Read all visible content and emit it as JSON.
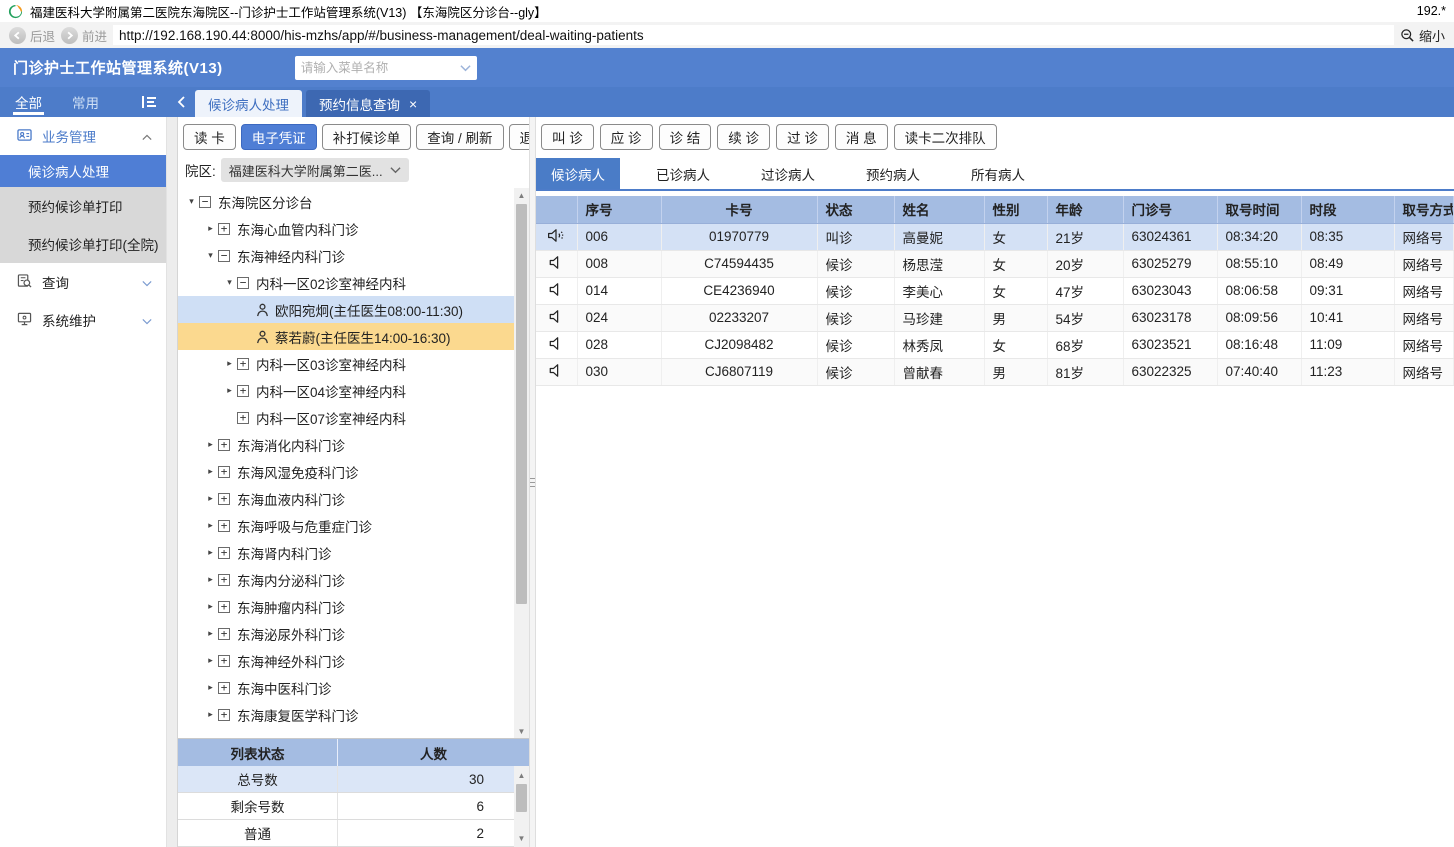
{
  "window": {
    "title": "福建医科大学附属第二医院东海院区--门诊护士工作站管理系统(V13) 【东海院区分诊台--gly】",
    "right_text": "192.*"
  },
  "navbar": {
    "back_label": "后退",
    "forward_label": "前进",
    "url": "http://192.168.190.44:8000/his-mzhs/app/#/business-management/deal-waiting-patients",
    "zoom_out_label": "缩小"
  },
  "app_header": {
    "title": "门诊护士工作站管理系统(V13)",
    "menu_search_placeholder": "请输入菜单名称"
  },
  "nav_tabs": {
    "side_tabs": [
      {
        "label": "全部",
        "active": true
      },
      {
        "label": "常用",
        "active": false
      }
    ],
    "doc_tabs": [
      {
        "label": "候诊病人处理",
        "active": true,
        "closable": false
      },
      {
        "label": "预约信息查询",
        "active": false,
        "closable": true
      }
    ],
    "close_glyph": "×"
  },
  "sidebar": {
    "items": [
      {
        "type": "group",
        "icon": "business-icon",
        "label": "业务管理",
        "expanded": true,
        "accent": true
      },
      {
        "type": "item",
        "label": "候诊病人处理",
        "active": true
      },
      {
        "type": "item",
        "label": "预约候诊单打印",
        "active": false
      },
      {
        "type": "item",
        "label": "预约候诊单打印(全院)",
        "active": false
      },
      {
        "type": "group",
        "icon": "query-icon",
        "label": "查询",
        "expanded": false,
        "accent": false
      },
      {
        "type": "group",
        "icon": "maintenance-icon",
        "label": "系统维护",
        "expanded": false,
        "accent": false
      }
    ]
  },
  "tree_panel": {
    "toolbar": [
      {
        "label": "读 卡",
        "primary": false
      },
      {
        "label": "电子凭证",
        "primary": true
      },
      {
        "label": "补打候诊单",
        "primary": false
      },
      {
        "label": "查询 / 刷新",
        "primary": false
      },
      {
        "label": "退 出",
        "primary": false
      }
    ],
    "campus_label": "院区:",
    "campus_value": "福建医科大学附属第二医...",
    "tree": [
      {
        "level": 0,
        "arrow": "down",
        "box": "minus",
        "person": false,
        "label": "东海院区分诊台",
        "highlight": ""
      },
      {
        "level": 1,
        "arrow": "right",
        "box": "plus",
        "person": false,
        "label": "东海心血管内科门诊",
        "highlight": ""
      },
      {
        "level": 1,
        "arrow": "down",
        "box": "minus",
        "person": false,
        "label": "东海神经内科门诊",
        "highlight": ""
      },
      {
        "level": 2,
        "arrow": "down",
        "box": "minus",
        "person": false,
        "label": "内科一区02诊室神经内科",
        "highlight": ""
      },
      {
        "level": 3,
        "arrow": "none",
        "box": "none",
        "person": true,
        "label": "欧阳宛炯(主任医生08:00-11:30)",
        "highlight": "blue"
      },
      {
        "level": 3,
        "arrow": "none",
        "box": "none",
        "person": true,
        "label": "蔡若蔚(主任医生14:00-16:30)",
        "highlight": "orange"
      },
      {
        "level": 2,
        "arrow": "right",
        "box": "plus",
        "person": false,
        "label": "内科一区03诊室神经内科",
        "highlight": ""
      },
      {
        "level": 2,
        "arrow": "right",
        "box": "plus",
        "person": false,
        "label": "内科一区04诊室神经内科",
        "highlight": ""
      },
      {
        "level": 2,
        "arrow": "none",
        "box": "plus",
        "person": false,
        "label": "内科一区07诊室神经内科",
        "highlight": ""
      },
      {
        "level": 1,
        "arrow": "right",
        "box": "plus",
        "person": false,
        "label": "东海消化内科门诊",
        "highlight": ""
      },
      {
        "level": 1,
        "arrow": "right",
        "box": "plus",
        "person": false,
        "label": "东海风湿免疫科门诊",
        "highlight": ""
      },
      {
        "level": 1,
        "arrow": "right",
        "box": "plus",
        "person": false,
        "label": "东海血液内科门诊",
        "highlight": ""
      },
      {
        "level": 1,
        "arrow": "right",
        "box": "plus",
        "person": false,
        "label": "东海呼吸与危重症门诊",
        "highlight": ""
      },
      {
        "level": 1,
        "arrow": "right",
        "box": "plus",
        "person": false,
        "label": "东海肾内科门诊",
        "highlight": ""
      },
      {
        "level": 1,
        "arrow": "right",
        "box": "plus",
        "person": false,
        "label": "东海内分泌科门诊",
        "highlight": ""
      },
      {
        "level": 1,
        "arrow": "right",
        "box": "plus",
        "person": false,
        "label": "东海肿瘤内科门诊",
        "highlight": ""
      },
      {
        "level": 1,
        "arrow": "right",
        "box": "plus",
        "person": false,
        "label": "东海泌尿外科门诊",
        "highlight": ""
      },
      {
        "level": 1,
        "arrow": "right",
        "box": "plus",
        "person": false,
        "label": "东海神经外科门诊",
        "highlight": ""
      },
      {
        "level": 1,
        "arrow": "right",
        "box": "plus",
        "person": false,
        "label": "东海中医科门诊",
        "highlight": ""
      },
      {
        "level": 1,
        "arrow": "right",
        "box": "plus",
        "person": false,
        "label": "东海康复医学科门诊",
        "highlight": ""
      }
    ],
    "stats": {
      "headers": [
        "列表状态",
        "人数"
      ],
      "rows": [
        {
          "label": "总号数",
          "value": "30",
          "highlight": true
        },
        {
          "label": "剩余号数",
          "value": "6",
          "highlight": false
        },
        {
          "label": "普通",
          "value": "2",
          "highlight": false
        }
      ]
    }
  },
  "patient_panel": {
    "toolbar": [
      {
        "label": "叫 诊"
      },
      {
        "label": "应 诊"
      },
      {
        "label": "诊 结"
      },
      {
        "label": "续 诊"
      },
      {
        "label": "过 诊"
      },
      {
        "label": "消 息"
      },
      {
        "label": "读卡二次排队"
      }
    ],
    "tabs": [
      {
        "label": "候诊病人",
        "active": true
      },
      {
        "label": "已诊病人",
        "active": false
      },
      {
        "label": "过诊病人",
        "active": false
      },
      {
        "label": "预约病人",
        "active": false
      },
      {
        "label": "所有病人",
        "active": false
      }
    ],
    "table": {
      "columns": [
        "",
        "序号",
        "卡号",
        "状态",
        "姓名",
        "性别",
        "年龄",
        "门诊号",
        "取号时间",
        "时段",
        "取号方式"
      ],
      "rows": [
        {
          "seq": "006",
          "card": "01970779",
          "status": "叫诊",
          "name": "高曼妮",
          "sex": "女",
          "age": "21岁",
          "clinic_no": "63024361",
          "take_time": "08:34:20",
          "slot": "08:35",
          "method": "网络号",
          "calling": true,
          "selected": true
        },
        {
          "seq": "008",
          "card": "C74594435",
          "status": "候诊",
          "name": "杨思滢",
          "sex": "女",
          "age": "20岁",
          "clinic_no": "63025279",
          "take_time": "08:55:10",
          "slot": "08:49",
          "method": "网络号",
          "calling": false,
          "selected": false
        },
        {
          "seq": "014",
          "card": "CE4236940",
          "status": "候诊",
          "name": "李美心",
          "sex": "女",
          "age": "47岁",
          "clinic_no": "63023043",
          "take_time": "08:06:58",
          "slot": "09:31",
          "method": "网络号",
          "calling": false,
          "selected": false
        },
        {
          "seq": "024",
          "card": "02233207",
          "status": "候诊",
          "name": "马珍建",
          "sex": "男",
          "age": "54岁",
          "clinic_no": "63023178",
          "take_time": "08:09:56",
          "slot": "10:41",
          "method": "网络号",
          "calling": false,
          "selected": false
        },
        {
          "seq": "028",
          "card": "CJ2098482",
          "status": "候诊",
          "name": "林秀凤",
          "sex": "女",
          "age": "68岁",
          "clinic_no": "63023521",
          "take_time": "08:16:48",
          "slot": "11:09",
          "method": "网络号",
          "calling": false,
          "selected": false
        },
        {
          "seq": "030",
          "card": "CJ6807119",
          "status": "候诊",
          "name": "曾献春",
          "sex": "男",
          "age": "81岁",
          "clinic_no": "63022325",
          "take_time": "07:40:40",
          "slot": "11:23",
          "method": "网络号",
          "calling": false,
          "selected": false
        }
      ]
    }
  },
  "icons": {
    "logo": "hospital-logo-swirl",
    "speaker_calling": "speaker-active-icon",
    "speaker_idle": "speaker-icon",
    "zoom_out": "magnifier-minus-icon"
  },
  "colors": {
    "header_blue": "#5381cf",
    "tabstrip_blue": "#4d7cc9",
    "accent_blue": "#4f7ed5",
    "inactive_doc_tab": "#3d68b2",
    "table_header": "#a4bce2",
    "selected_row": "#d4e1f5",
    "doctor_row_blue": "#cfdff5",
    "doctor_row_orange": "#fbd98f",
    "submenu_gray": "#d8d8d8"
  }
}
